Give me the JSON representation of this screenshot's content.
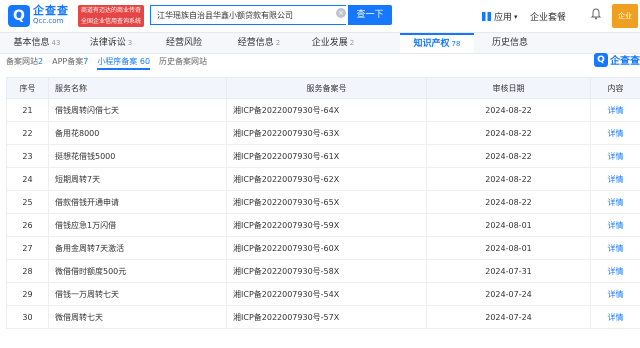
{
  "header": {
    "logo_mark": "Q",
    "logo_name": "企查查",
    "logo_domain": "Qcc.com",
    "slogan_line1": "商道有迈达的商业传奇",
    "slogan_line2": "全国企业信用查询系统",
    "search_value": "江华瑶族自治县华鑫小额贷款有限公司",
    "search_button": "查一下",
    "nav_app": "应用",
    "nav_package": "企业套餐",
    "avatar_text": "企业"
  },
  "tabs": [
    {
      "label": "基本信息",
      "count": "43"
    },
    {
      "label": "法律诉讼",
      "count": "3"
    },
    {
      "label": "经营风险",
      "count": ""
    },
    {
      "label": "经营信息",
      "count": "2"
    },
    {
      "label": "企业发展",
      "count": "2"
    },
    {
      "label": "知识产权",
      "count": "78"
    },
    {
      "label": "历史信息",
      "count": ""
    }
  ],
  "subtabs": [
    {
      "label": "备案网站",
      "count": "2"
    },
    {
      "label": "APP备案",
      "count": "7"
    },
    {
      "label": "小程序备案",
      "count": "60"
    },
    {
      "label": "历史备案网站",
      "count": ""
    }
  ],
  "watermark": "企查查",
  "table": {
    "headers": [
      "序号",
      "服务名称",
      "服务备案号",
      "审核日期",
      "内容"
    ],
    "rows": [
      {
        "no": "21",
        "name": "借钱周转闪借七天",
        "record": "湘ICP备2022007930号-64X",
        "date": "2024-08-22",
        "action": "详情"
      },
      {
        "no": "22",
        "name": "备用花8000",
        "record": "湘ICP备2022007930号-63X",
        "date": "2024-08-22",
        "action": "详情"
      },
      {
        "no": "23",
        "name": "挺想花借钱5000",
        "record": "湘ICP备2022007930号-61X",
        "date": "2024-08-22",
        "action": "详情"
      },
      {
        "no": "24",
        "name": "短期周转7天",
        "record": "湘ICP备2022007930号-62X",
        "date": "2024-08-22",
        "action": "详情"
      },
      {
        "no": "25",
        "name": "借款借钱开通申请",
        "record": "湘ICP备2022007930号-65X",
        "date": "2024-08-22",
        "action": "详情"
      },
      {
        "no": "26",
        "name": "借钱应急1万闪借",
        "record": "湘ICP备2022007930号-59X",
        "date": "2024-08-01",
        "action": "详情"
      },
      {
        "no": "27",
        "name": "备用金周转7天激活",
        "record": "湘ICP备2022007930号-60X",
        "date": "2024-08-01",
        "action": "详情"
      },
      {
        "no": "28",
        "name": "微借借时额度500元",
        "record": "湘ICP备2022007930号-58X",
        "date": "2024-07-31",
        "action": "详情"
      },
      {
        "no": "29",
        "name": "借钱一万周转七天",
        "record": "湘ICP备2022007930号-54X",
        "date": "2024-07-24",
        "action": "详情"
      },
      {
        "no": "30",
        "name": "微借周转七天",
        "record": "湘ICP备2022007930号-57X",
        "date": "2024-07-24",
        "action": "详情"
      }
    ]
  }
}
